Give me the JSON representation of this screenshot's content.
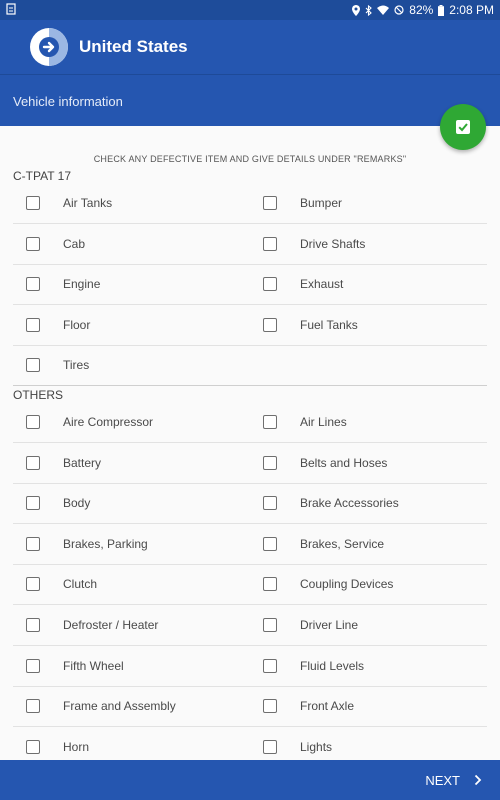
{
  "status_bar": {
    "left_icon": "notification-icon",
    "battery": "82%",
    "time": "2:08 PM"
  },
  "app_bar": {
    "title": "United States",
    "logo_icon": "arrow-right-circle-icon"
  },
  "sub_bar": {
    "title": "Vehicle information"
  },
  "fab": {
    "icon": "check-box-icon",
    "color": "#2fa834"
  },
  "instructions": "CHECK ANY DEFECTIVE ITEM AND GIVE DETAILS UNDER \"REMARKS\"",
  "sections": [
    {
      "title": "C-TPAT 17",
      "rows": [
        [
          "Air Tanks",
          "Bumper"
        ],
        [
          "Cab",
          "Drive Shafts"
        ],
        [
          "Engine",
          "Exhaust"
        ],
        [
          "Floor",
          "Fuel Tanks"
        ],
        [
          "Tires",
          ""
        ]
      ]
    },
    {
      "title": "OTHERS",
      "rows": [
        [
          "Aire Compressor",
          "Air Lines"
        ],
        [
          "Battery",
          "Belts and Hoses"
        ],
        [
          "Body",
          "Brake Accessories"
        ],
        [
          "Brakes, Parking",
          "Brakes, Service"
        ],
        [
          "Clutch",
          "Coupling Devices"
        ],
        [
          "Defroster / Heater",
          "Driver Line"
        ],
        [
          "Fifth Wheel",
          "Fluid Levels"
        ],
        [
          "Frame and Assembly",
          "Front Axle"
        ],
        [
          "Horn",
          "Lights"
        ]
      ]
    }
  ],
  "bottom_bar": {
    "next_label": "NEXT"
  },
  "colors": {
    "primary": "#2556b0",
    "status_bar": "#1e4c9a",
    "accent": "#2fa834"
  }
}
